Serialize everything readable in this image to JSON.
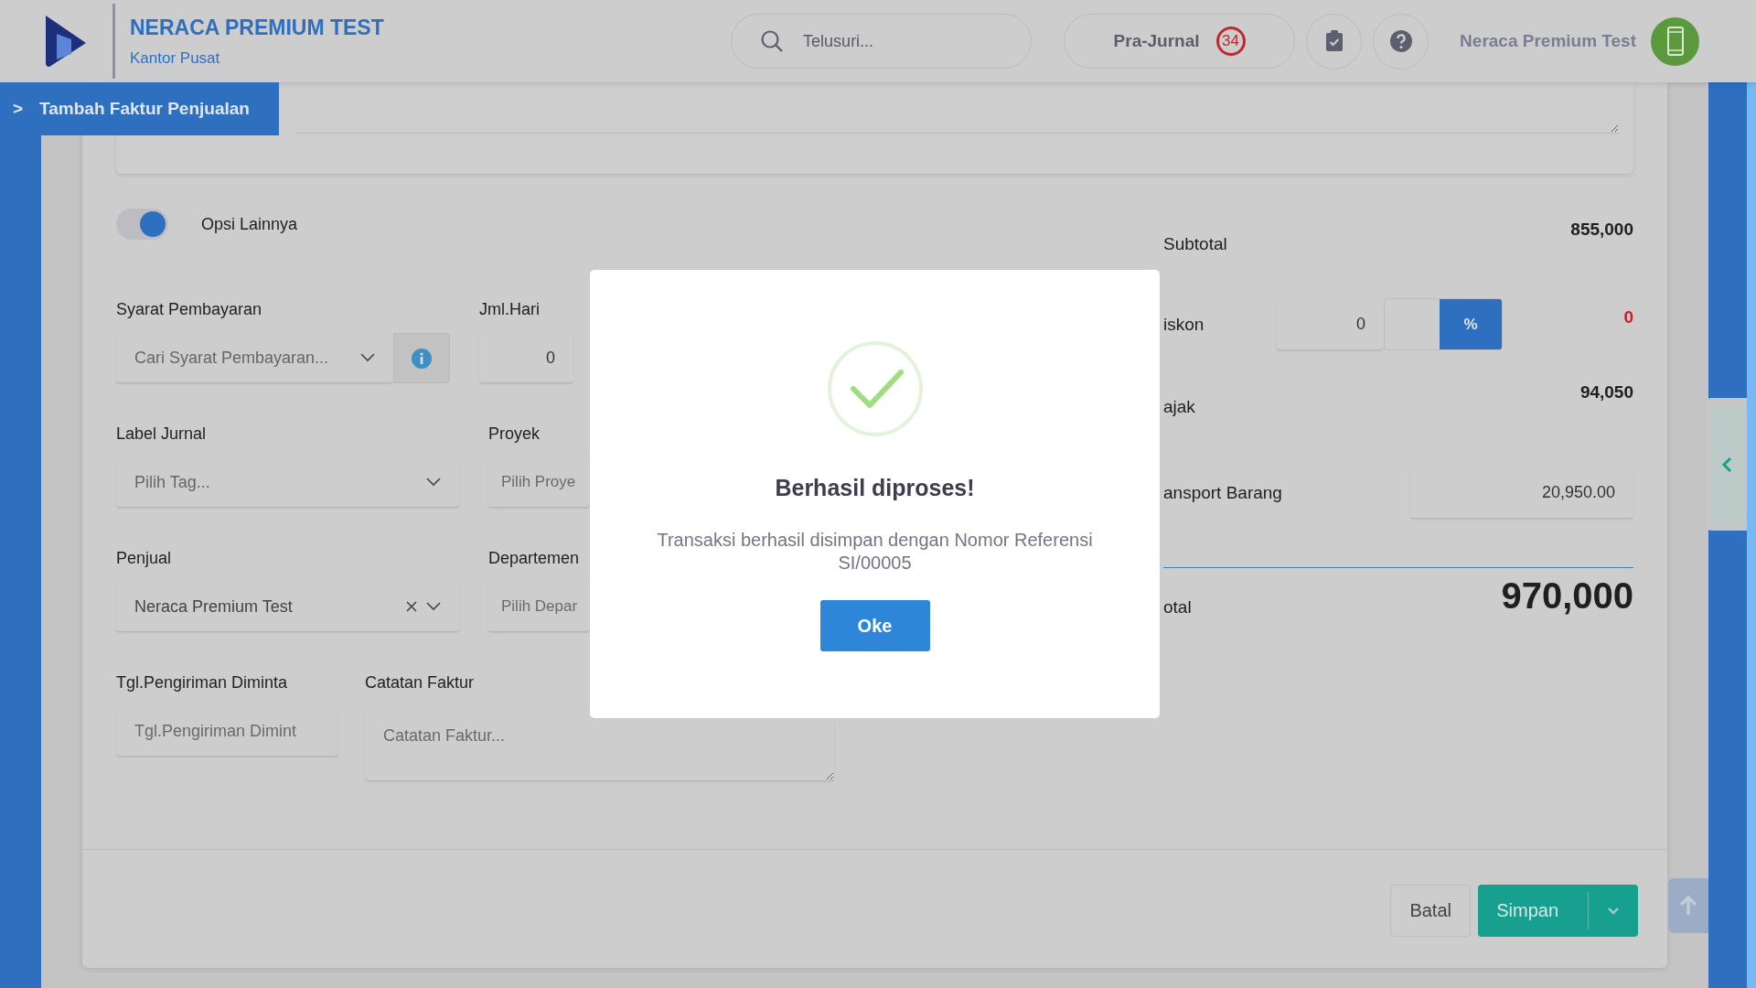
{
  "app": {
    "title": "NERACA PREMIUM TEST",
    "subtitle": "Kantor Pusat"
  },
  "header": {
    "search": {
      "placeholder": "Telusuri..."
    },
    "pra_jurnal": {
      "label": "Pra-Jurnal",
      "count": "34"
    },
    "user_name": "Neraca Premium Test"
  },
  "breadcrumb": {
    "arrow": ">",
    "title": "Tambah Faktur Penjualan"
  },
  "options_toggle": {
    "label": "Opsi Lainnya",
    "on": true
  },
  "form_rows": [
    [
      {
        "label": "Syarat Pembayaran",
        "kind": "select_info",
        "placeholder": "Cari Syarat Pembayaran..."
      },
      {
        "label": "Jml.Hari",
        "kind": "number",
        "value": "0"
      }
    ],
    [
      {
        "label": "Label Jurnal",
        "kind": "select",
        "placeholder": "Pilih Tag..."
      },
      {
        "label": "Proyek",
        "kind": "text",
        "placeholder": "Pilih Proye"
      }
    ],
    [
      {
        "label": "Penjual",
        "kind": "select_clear",
        "value": "Neraca Premium Test"
      },
      {
        "label": "Departemen",
        "kind": "text",
        "placeholder": "Pilih Depar"
      }
    ],
    [
      {
        "label": "Tgl.Pengiriman Diminta",
        "kind": "text",
        "placeholder": "Tgl.Pengiriman Dimint"
      },
      {
        "label": "Catatan Faktur",
        "kind": "textarea",
        "placeholder": "Catatan Faktur..."
      }
    ]
  ],
  "summary": [
    {
      "kind": "amount",
      "label": "Subtotal",
      "value": "855,000"
    },
    {
      "kind": "discount",
      "label": "iskon",
      "input": "0",
      "unit": "%",
      "value": "0"
    },
    {
      "kind": "amount",
      "label": "ajak",
      "value": "94,050"
    },
    {
      "kind": "input",
      "label": "ansport Barang",
      "input": "20,950.00"
    },
    {
      "kind": "total",
      "label": "otal",
      "value": "970,000"
    }
  ],
  "footer_buttons": [
    {
      "kind": "secondary",
      "label": "Batal"
    },
    {
      "kind": "primary_split",
      "label": "Simpan"
    }
  ],
  "modal": {
    "title": "Berhasil diproses!",
    "message": "Transaksi berhasil disimpan dengan Nomor Referensi SI/00005",
    "button": "Oke"
  }
}
